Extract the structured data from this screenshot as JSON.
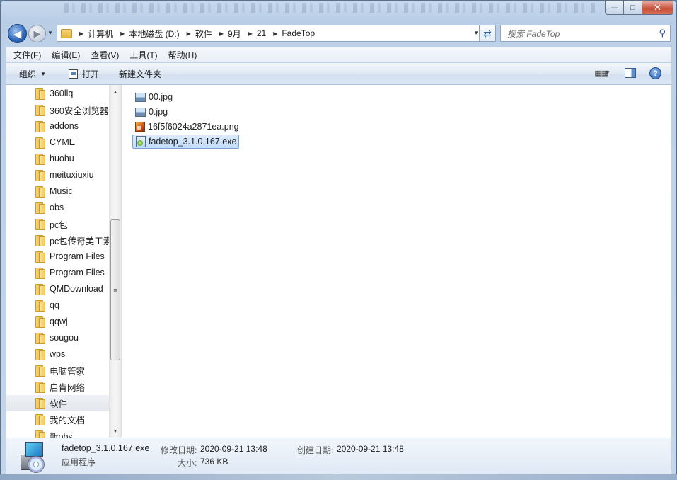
{
  "addressbar": {
    "crumbs": [
      "计算机",
      "本地磁盘 (D:)",
      "软件",
      "9月",
      "21",
      "FadeTop"
    ]
  },
  "search": {
    "placeholder": "搜索 FadeTop"
  },
  "caption": {
    "minimize": "—",
    "maximize": "□",
    "close": "✕"
  },
  "menubar": {
    "items": [
      "文件(F)",
      "编辑(E)",
      "查看(V)",
      "工具(T)",
      "帮助(H)"
    ]
  },
  "commandbar": {
    "organize": "组织",
    "open": "打开",
    "new_folder": "新建文件夹",
    "help": "?"
  },
  "sidebar": {
    "items": [
      {
        "label": "360llq"
      },
      {
        "label": "360安全浏览器"
      },
      {
        "label": "addons"
      },
      {
        "label": "CYME"
      },
      {
        "label": "huohu"
      },
      {
        "label": "meituxiuxiu"
      },
      {
        "label": "Music"
      },
      {
        "label": "obs"
      },
      {
        "label": "pc包"
      },
      {
        "label": "pc包传奇美工素"
      },
      {
        "label": "Program Files"
      },
      {
        "label": "Program Files"
      },
      {
        "label": "QMDownload"
      },
      {
        "label": "qq"
      },
      {
        "label": "qqwj"
      },
      {
        "label": "sougou"
      },
      {
        "label": "wps"
      },
      {
        "label": "电脑管家"
      },
      {
        "label": "启肯网络"
      },
      {
        "label": "软件",
        "selected": true
      },
      {
        "label": "我的文档"
      },
      {
        "label": "新obs"
      }
    ]
  },
  "files": [
    {
      "name": "00.jpg",
      "icon": "image-icon"
    },
    {
      "name": "0.jpg",
      "icon": "image-icon"
    },
    {
      "name": "16f5f6024a2871ea.png",
      "icon": "png-icon"
    },
    {
      "name": "fadetop_3.1.0.167.exe",
      "icon": "exe-icon",
      "selected": true
    }
  ],
  "details": {
    "name": "fadetop_3.1.0.167.exe",
    "type": "应用程序",
    "modified_label": "修改日期:",
    "modified_value": "2020-09-21 13:48",
    "size_label": "大小:",
    "size_value": "736 KB",
    "created_label": "创建日期:",
    "created_value": "2020-09-21 13:48"
  },
  "colors": {
    "selection_bg": "#cce4fb",
    "selection_border": "#7da2ce",
    "window_frame": "#bcd0e7"
  }
}
